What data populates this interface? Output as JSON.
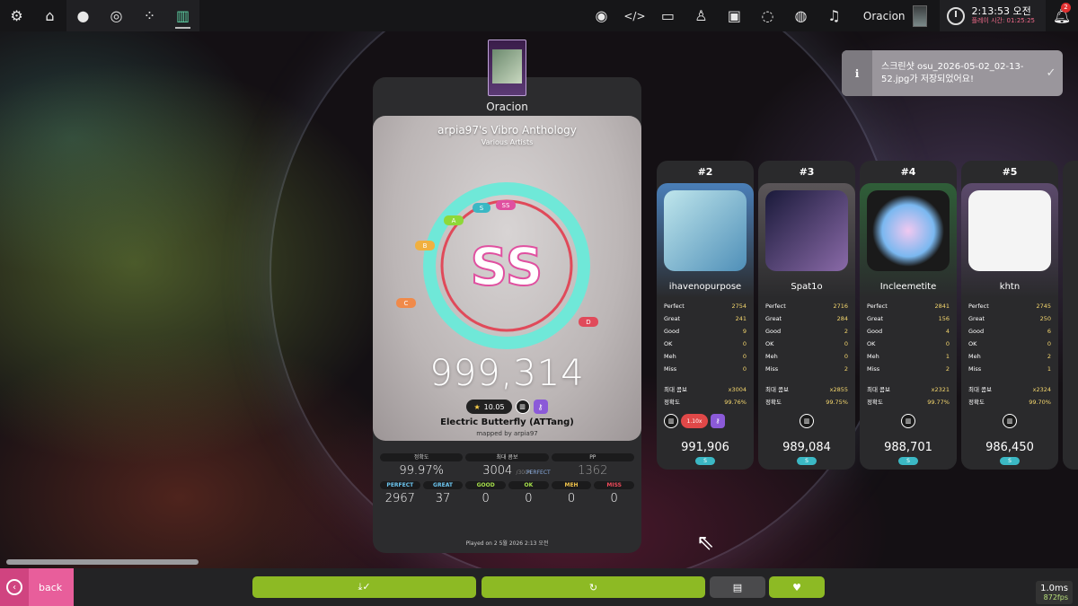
{
  "toolbar": {
    "left_icons": [
      "settings-icon",
      "home-icon"
    ],
    "ruleset_icons": [
      "osu-icon",
      "taiko-icon",
      "catch-icon",
      "mania-icon"
    ],
    "right_icons": [
      "news-icon",
      "code-icon",
      "screen-icon",
      "ranking-icon",
      "beatmap-listing-icon",
      "chat-icon",
      "globe-icon",
      "music-icon"
    ],
    "now_playing": "Oracion",
    "clock": {
      "time": "2:13:53 오전",
      "sub": "플레이 시간: 01:25:25"
    },
    "notification_count": "2"
  },
  "toast": {
    "text": "스크린샷 osu_2026-05-02_02-13-52.jpg가 저장되었어요!"
  },
  "result": {
    "difficulty_name": "Oracion",
    "beatmap_title": "arpia97's Vibro Anthology",
    "artist": "Various Artists",
    "rank": "SS",
    "rank_markers": [
      "D",
      "C",
      "B",
      "A",
      "S",
      "SS"
    ],
    "score": "999,314",
    "star_rating": "10.05",
    "song_name": "Electric Butterfly (ATTang)",
    "mapper": "mapped by arpia97",
    "accuracy_label": "정확도",
    "accuracy": "99.97%",
    "combo_label": "최대 콤보",
    "combo": "3004",
    "combo_max": "/3004",
    "perfect_tag": "PERFECT",
    "pp_label": "PP",
    "pp": "1362",
    "hits": [
      {
        "label": "PERFECT",
        "value": "2967",
        "color": "#6cc6f0"
      },
      {
        "label": "GREAT",
        "value": "37",
        "color": "#6cc6f0"
      },
      {
        "label": "GOOD",
        "value": "0",
        "color": "#a6e04a"
      },
      {
        "label": "OK",
        "value": "0",
        "color": "#a6e04a"
      },
      {
        "label": "MEH",
        "value": "0",
        "color": "#f0c24a"
      },
      {
        "label": "MISS",
        "value": "0",
        "color": "#f04a5a"
      }
    ],
    "played_on": "Played on 2 5월 2026 2:13 오전"
  },
  "cards": [
    {
      "rank": "#2",
      "name": "ihavenopurpose",
      "stats": [
        [
          "Perfect",
          "2754"
        ],
        [
          "Great",
          "241"
        ],
        [
          "Good",
          "9"
        ],
        [
          "OK",
          "0"
        ],
        [
          "Meh",
          "0"
        ],
        [
          "Miss",
          "0"
        ]
      ],
      "combo": "x3004",
      "accuracy": "99.76%",
      "score": "991,906",
      "grade": "S",
      "color": "#4a7fb8",
      "mods": [
        "mania-mod",
        "dt-mod",
        "key-mod"
      ],
      "dt": "1.10x"
    },
    {
      "rank": "#3",
      "name": "Spat1o",
      "stats": [
        [
          "Perfect",
          "2716"
        ],
        [
          "Great",
          "284"
        ],
        [
          "Good",
          "2"
        ],
        [
          "OK",
          "0"
        ],
        [
          "Meh",
          "0"
        ],
        [
          "Miss",
          "2"
        ]
      ],
      "combo": "x2855",
      "accuracy": "99.75%",
      "score": "989,084",
      "grade": "S",
      "color": "#3e3a3c",
      "mods": [
        "mania-mod"
      ]
    },
    {
      "rank": "#4",
      "name": "Incleemetite",
      "stats": [
        [
          "Perfect",
          "2841"
        ],
        [
          "Great",
          "156"
        ],
        [
          "Good",
          "4"
        ],
        [
          "OK",
          "0"
        ],
        [
          "Meh",
          "1"
        ],
        [
          "Miss",
          "2"
        ]
      ],
      "combo": "x2321",
      "accuracy": "99.77%",
      "score": "988,701",
      "grade": "S",
      "color": "#2f5e38",
      "mods": [
        "mania-mod"
      ]
    },
    {
      "rank": "#5",
      "name": "khtn",
      "stats": [
        [
          "Perfect",
          "2745"
        ],
        [
          "Great",
          "250"
        ],
        [
          "Good",
          "6"
        ],
        [
          "OK",
          "0"
        ],
        [
          "Meh",
          "2"
        ],
        [
          "Miss",
          "1"
        ]
      ],
      "combo": "x2324",
      "accuracy": "99.70%",
      "score": "986,450",
      "grade": "S",
      "color": "#5c4a6c",
      "mods": [
        "mania-mod"
      ]
    }
  ],
  "card_labels": {
    "combo": "최대 콤보",
    "accuracy": "정확도"
  },
  "footer": {
    "back_label": "back",
    "buttons": [
      "download-icon",
      "retry-icon",
      "collection-icon",
      "favourite-icon"
    ],
    "latency": "1.0ms",
    "fps": "872fps"
  }
}
